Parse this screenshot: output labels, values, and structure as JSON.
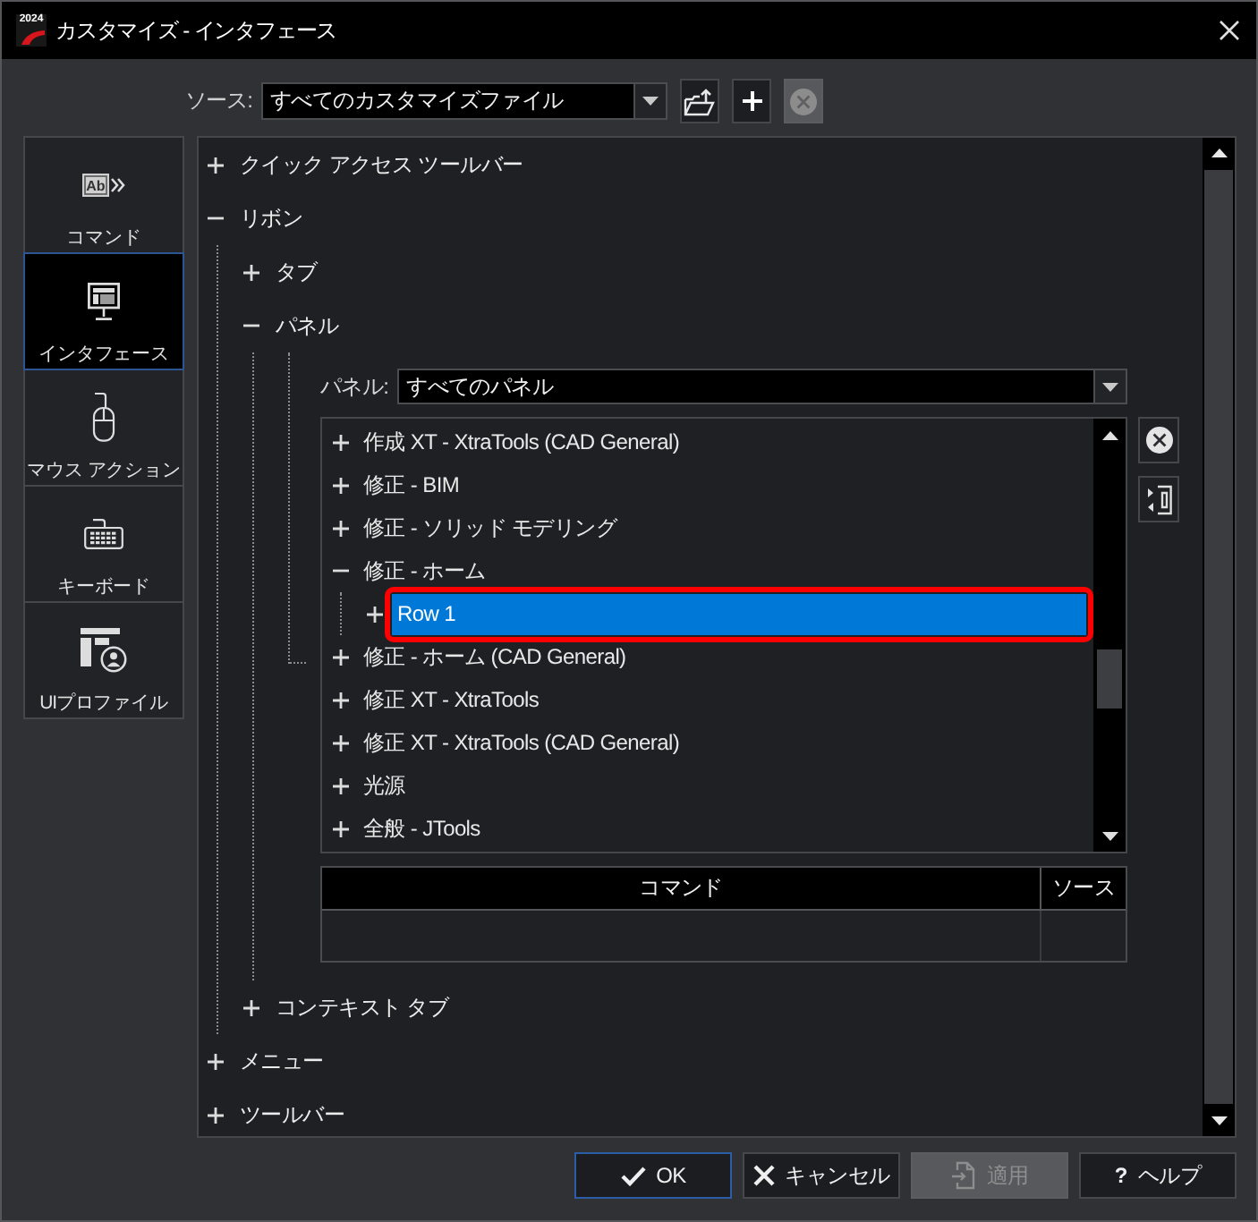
{
  "window": {
    "title": "カスタマイズ - インタフェース",
    "logo_text": "2024"
  },
  "source": {
    "label": "ソース:",
    "value": "すべてのカスタマイズファイル",
    "buttons": [
      {
        "kind": "open",
        "disabled": false
      },
      {
        "kind": "add",
        "disabled": false
      },
      {
        "kind": "remove",
        "disabled": true
      }
    ]
  },
  "sidebar": {
    "items": [
      {
        "kind": "command",
        "label": "コマンド",
        "icon_text": "Ab",
        "selected": false
      },
      {
        "kind": "interface",
        "label": "インタフェース",
        "selected": true
      },
      {
        "kind": "mouse",
        "label": "マウス アクション",
        "selected": false
      },
      {
        "kind": "keyboard",
        "label": "キーボード",
        "selected": false
      },
      {
        "kind": "profile",
        "label": "UIプロファイル",
        "selected": false
      }
    ]
  },
  "tree": {
    "items": [
      {
        "label": "クイック アクセス ツールバー",
        "expanded": false
      },
      {
        "label": "リボン",
        "expanded": true,
        "children": [
          {
            "label": "タブ",
            "expanded": false
          },
          {
            "label": "パネル",
            "expanded": true,
            "editor": {
              "filter": {
                "label": "パネル:",
                "value": "すべてのパネル"
              },
              "list": {
                "items": [
                  {
                    "label": "作成 XT - XtraTools (CAD General)",
                    "expanded": false,
                    "selected": false
                  },
                  {
                    "label": "修正 - BIM",
                    "expanded": false,
                    "selected": false
                  },
                  {
                    "label": "修正 - ソリッド モデリング",
                    "expanded": false,
                    "selected": false
                  },
                  {
                    "label": "修正 - ホーム",
                    "expanded": true,
                    "selected": false,
                    "children": [
                      {
                        "label": "Row 1",
                        "expanded": false,
                        "selected": true,
                        "highlighted": true
                      }
                    ]
                  },
                  {
                    "label": "修正 - ホーム (CAD General)",
                    "expanded": false,
                    "selected": false
                  },
                  {
                    "label": "修正 XT - XtraTools",
                    "expanded": false,
                    "selected": false
                  },
                  {
                    "label": "修正 XT - XtraTools (CAD General)",
                    "expanded": false,
                    "selected": false
                  },
                  {
                    "label": "光源",
                    "expanded": false,
                    "selected": false
                  },
                  {
                    "label": "全般 - JTools",
                    "expanded": false,
                    "selected": false
                  }
                ]
              },
              "list_buttons": [
                {
                  "kind": "remove"
                },
                {
                  "kind": "swap"
                }
              ],
              "table": {
                "columns": [
                  "コマンド",
                  "ソース"
                ]
              }
            }
          },
          {
            "label": "コンテキスト タブ",
            "expanded": false
          }
        ]
      },
      {
        "label": "メニュー",
        "expanded": false
      },
      {
        "label": "ツールバー",
        "expanded": false
      }
    ]
  },
  "buttons": [
    {
      "kind": "ok",
      "label": "OK",
      "default": true,
      "disabled": false
    },
    {
      "kind": "cancel",
      "label": "キャンセル",
      "default": false,
      "disabled": false
    },
    {
      "kind": "apply",
      "label": "適用",
      "default": false,
      "disabled": true
    },
    {
      "kind": "help",
      "label": "ヘルプ",
      "symbol": "?",
      "default": false,
      "disabled": false
    }
  ]
}
